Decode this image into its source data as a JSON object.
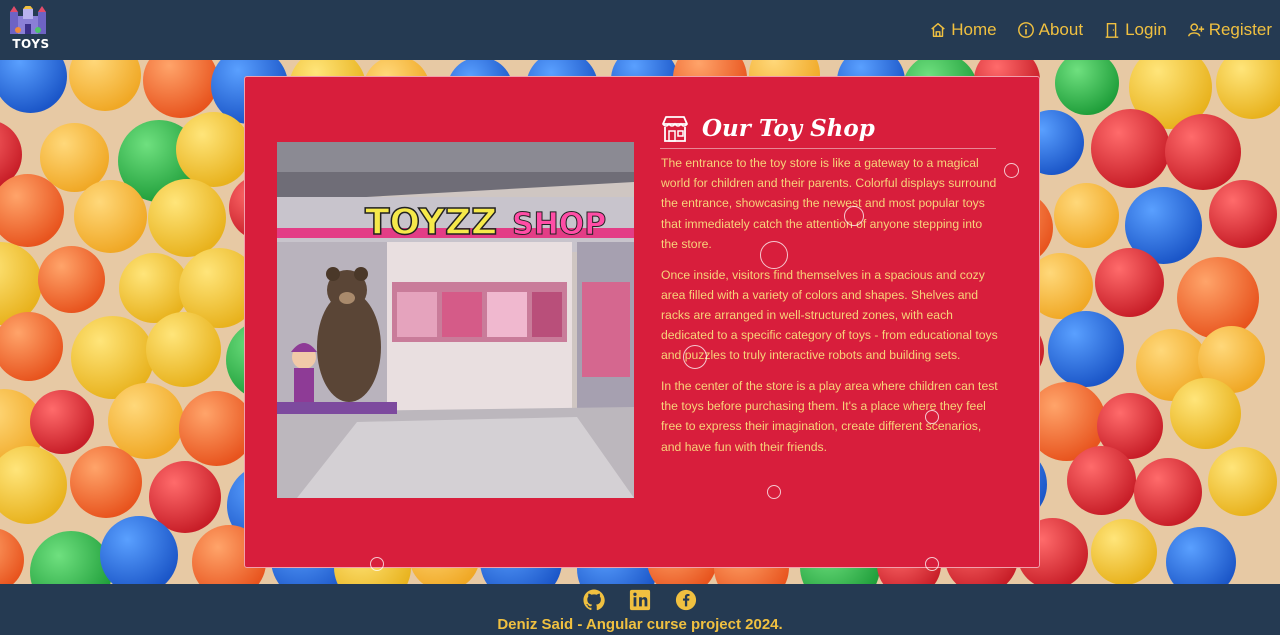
{
  "header": {
    "logo_text": "TOYS",
    "nav": [
      {
        "label": "Home",
        "icon": "home-icon"
      },
      {
        "label": "About",
        "icon": "info-icon"
      },
      {
        "label": "Login",
        "icon": "door-icon"
      },
      {
        "label": "Register",
        "icon": "user-plus-icon"
      }
    ]
  },
  "main": {
    "title": "Our Toy Shop",
    "title_icon": "shop-icon",
    "photo_sign": "TOYZZ SHOP",
    "paragraphs": [
      "The entrance to the toy store is like a gateway to a magical world for children and their parents. Colorful displays surround the entrance, showcasing the newest and most popular toys that immediately catch the attention of anyone stepping into the store.",
      "Once inside, visitors find themselves in a spacious and cozy area filled with a variety of colors and shapes. Shelves and racks are arranged in well-structured zones, with each dedicated to a specific category of toys - from educational toys and puzzles to truly interactive robots and building sets.",
      "In the center of the store is a play area where children can test the toys before purchasing them. It's a place where they feel free to express their imagination, create different scenarios, and have fun with their friends."
    ]
  },
  "footer": {
    "text": "Deniz Said - Angular curse project 2024.",
    "social": [
      "github-icon",
      "linkedin-icon",
      "facebook-icon"
    ]
  },
  "colors": {
    "navbar": "#253a52",
    "accent": "#f0c040",
    "card": "#d81e3c"
  }
}
